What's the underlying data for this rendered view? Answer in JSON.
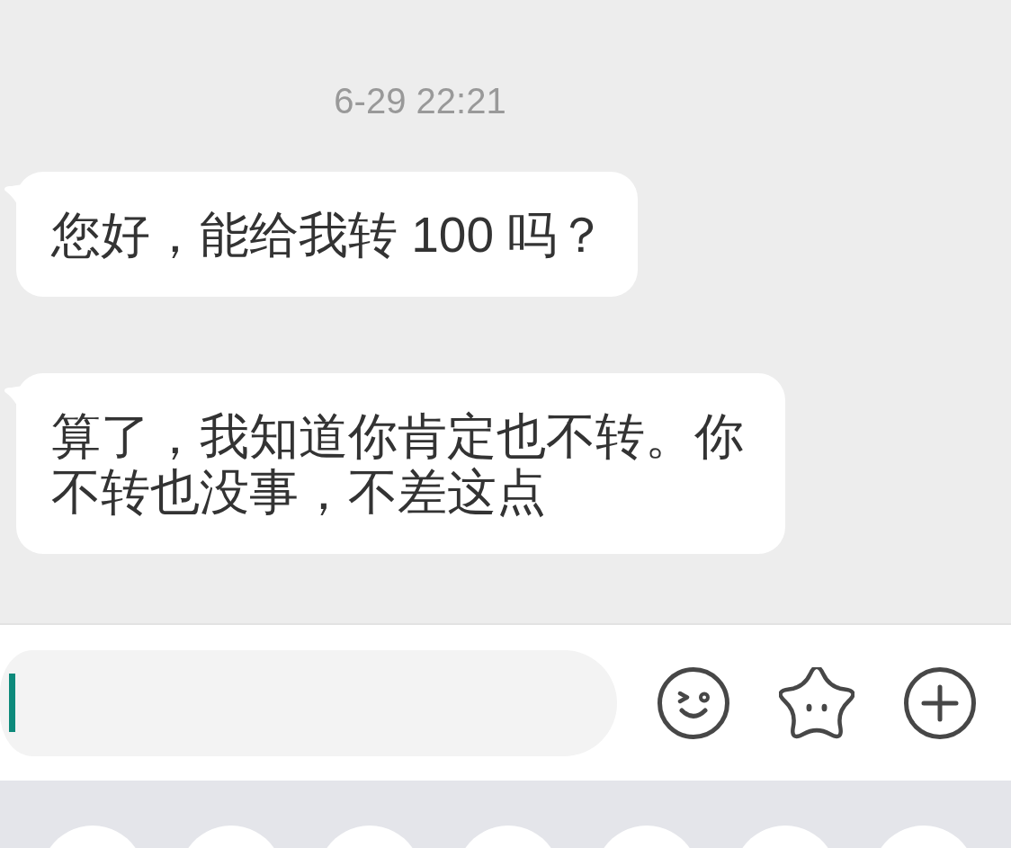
{
  "timestamp": "6-29 22:21",
  "messages": [
    {
      "text": "您好，能给我转 100 吗？"
    },
    {
      "text": "算了，我知道你肯定也不转。你不转也没事，不差这点"
    }
  ],
  "composer": {
    "focused": true
  }
}
